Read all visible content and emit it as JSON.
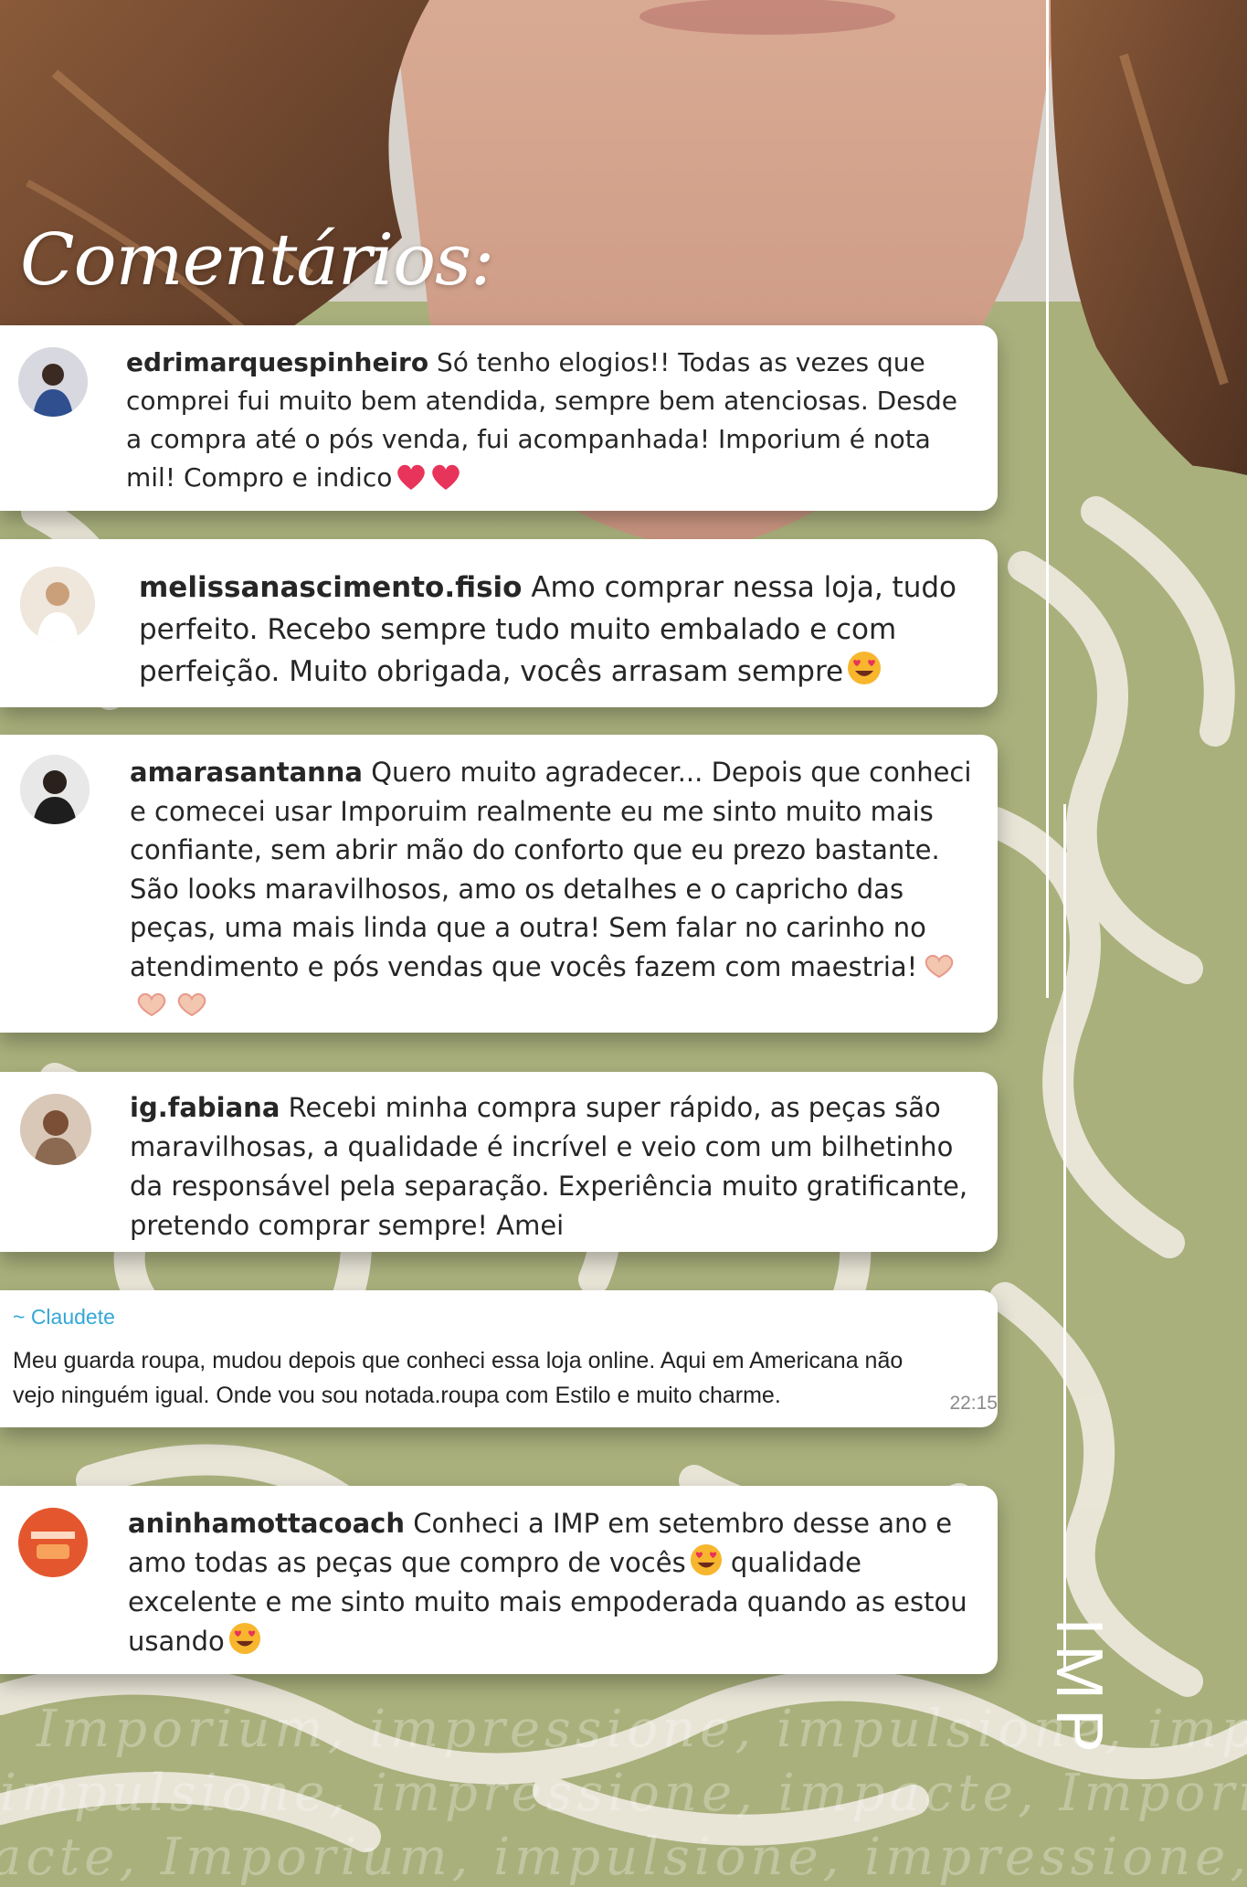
{
  "heading": "Comentários:",
  "colors": {
    "accent_olive": "#a9b07c",
    "card_bg": "#ffffff",
    "username": "#262626",
    "whatsapp_name": "#34a7d6"
  },
  "comments": [
    {
      "username": "edrimarquespinheiro",
      "text": " Só tenho elogios!! Todas as vezes que comprei fui muito bem atendida, sempre bem atenciosas. Desde a compra até o pós venda, fui acompanhada! Imporium é nota mil! Compro e indico",
      "emoji": "heart-emoji x2"
    },
    {
      "username": "melissanascimento.fisio",
      "text": " Amo comprar nessa loja, tudo perfeito. Recebo sempre tudo muito embalado e com perfeição. Muito obrigada, vocês arrasam sempre",
      "emoji": "heart-eyes-emoji"
    },
    {
      "username": "amarasantanna",
      "text": " Quero muito agradecer... Depois que conheci e comecei usar Imporuim realmente eu me sinto muito mais confiante, sem abrir mão do conforto que eu prezo bastante. São looks maravilhosos, amo os detalhes e o capricho das peças, uma mais linda que a outra! Sem falar no carinho no atendimento e pós vendas que vocês fazem com maestria!",
      "emoji": "hand-heart-emoji x3"
    },
    {
      "username": "ig.fabiana",
      "text": " Recebi minha compra super rápido, as peças são maravilhosas, a qualidade é incrível e veio com um bilhetinho da responsável pela separação. Experiência muito gratificante, pretendo comprar sempre! Amei"
    },
    {
      "username": "aninhamottacoach",
      "text_part1": " Conheci a IMP em setembro desse ano e amo todas as peças que compro de vocês",
      "text_part2": " qualidade excelente e me sinto muito mais empoderada quando as estou usando",
      "emoji": "heart-eyes-emoji"
    }
  ],
  "whatsapp": {
    "name": "~ Claudete",
    "text": "Meu guarda roupa, mudou depois que conheci essa loja online. Aqui em Americana não vejo ninguém igual. Onde vou sou notada.roupa com Estilo e muito charme.",
    "time": "22:15"
  },
  "logo": "IMP",
  "tagline_lines": [
    "Imporium, impressione, impulsione, impacte",
    "impulsione, impressione, impacte, Imporium",
    "acte, Imporium, impulsione, impressione, I"
  ]
}
